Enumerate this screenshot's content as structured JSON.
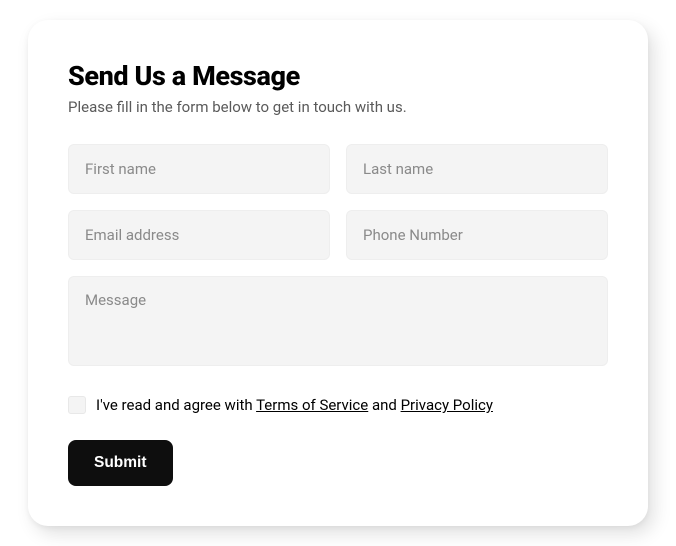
{
  "form": {
    "heading": "Send Us a Message",
    "subheading": "Please fill in the form below to get in touch with us.",
    "fields": {
      "first_name": {
        "placeholder": "First name",
        "value": ""
      },
      "last_name": {
        "placeholder": "Last name",
        "value": ""
      },
      "email": {
        "placeholder": "Email address",
        "value": ""
      },
      "phone": {
        "placeholder": "Phone Number",
        "value": ""
      },
      "message": {
        "placeholder": "Message",
        "value": ""
      }
    },
    "consent": {
      "checked": false,
      "prefix": "I've read and agree with ",
      "tos_label": "Terms of Service",
      "joiner": " and ",
      "privacy_label": "Privacy Policy"
    },
    "submit_label": "Submit"
  }
}
